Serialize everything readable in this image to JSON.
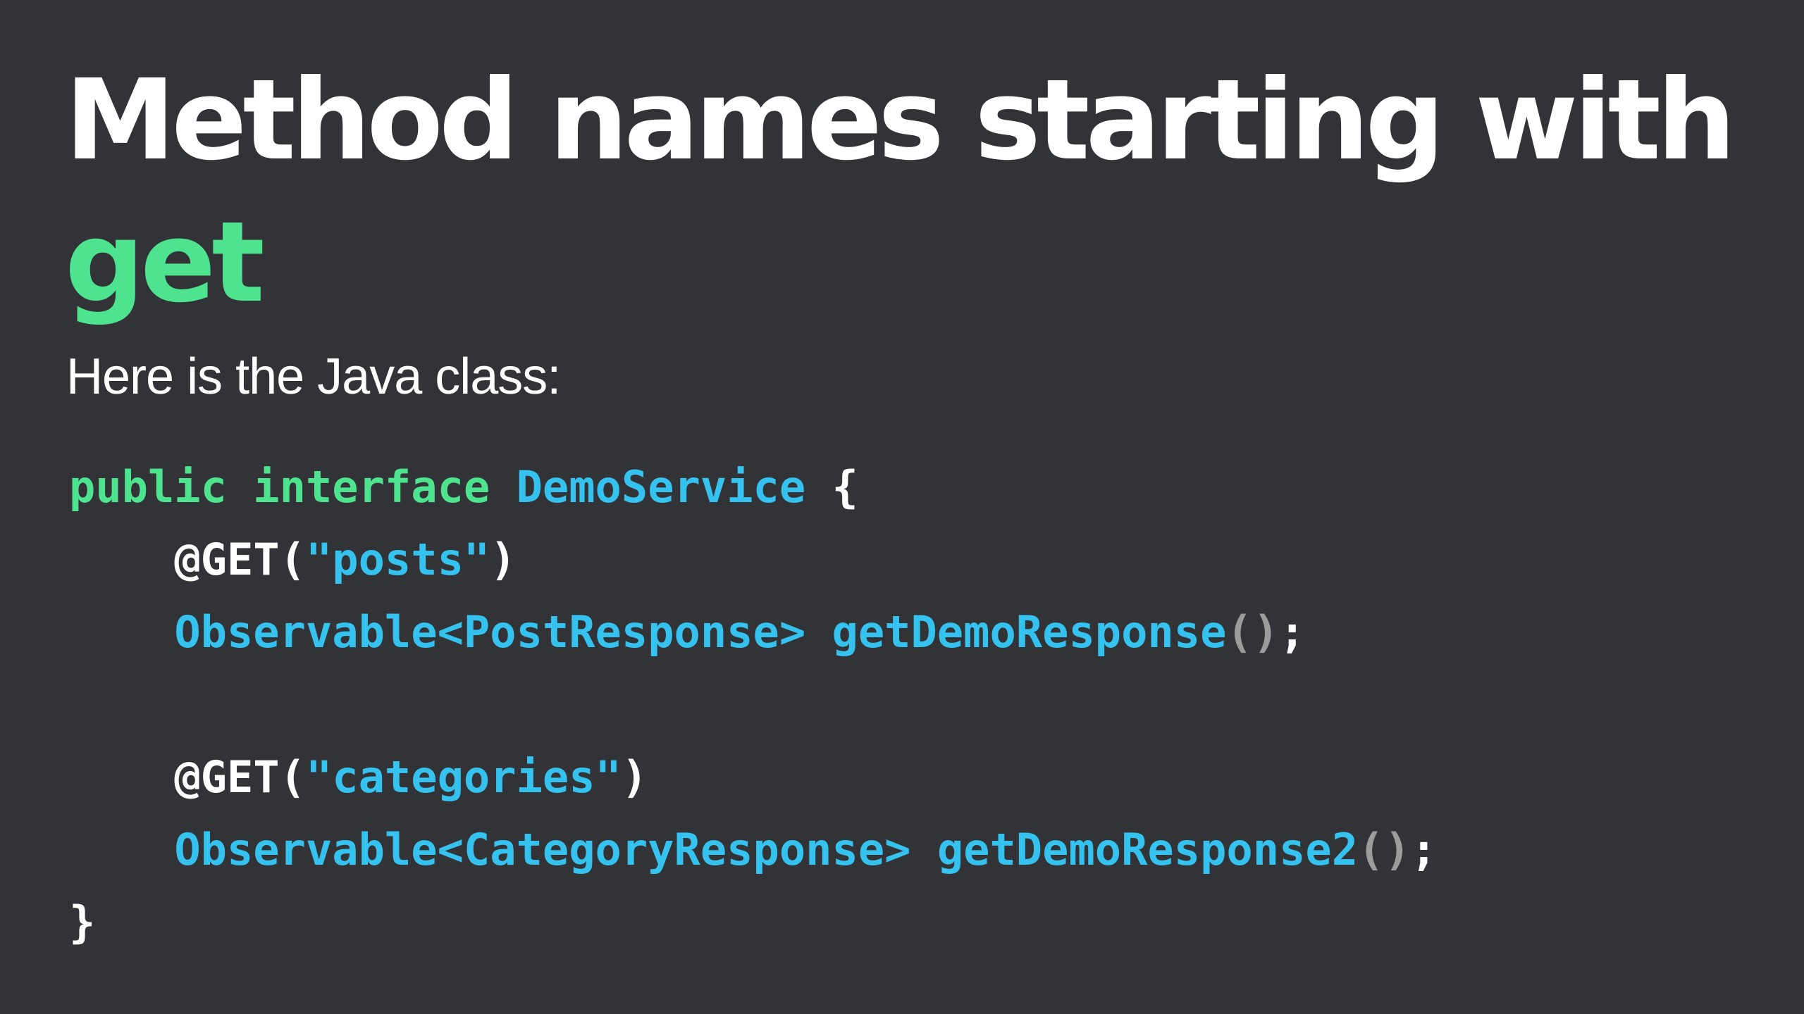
{
  "slide": {
    "title_line1": "Method names starting with",
    "title_line2": "get",
    "subtitle": "Here is the Java class:",
    "code": {
      "line1": {
        "kw1": "public",
        "kw2": "interface",
        "name": "DemoService",
        "brace": "{"
      },
      "line2": {
        "annotation": "@GET",
        "open": "(",
        "string": "\"posts\"",
        "close": ")"
      },
      "line3": {
        "type": "Observable<PostResponse>",
        "method": "getDemoResponse",
        "open": "(",
        "close": ")",
        "semi": ";"
      },
      "line5": {
        "annotation": "@GET",
        "open": "(",
        "string": "\"categories\"",
        "close": ")"
      },
      "line6": {
        "type": "Observable<CategoryResponse>",
        "method": "getDemoResponse2",
        "open": "(",
        "close": ")",
        "semi": ";"
      },
      "line7": {
        "brace": "}"
      }
    }
  },
  "colors": {
    "background": "#323337",
    "accent_green": "#4ee38e",
    "accent_blue": "#35c2ee",
    "text": "#ffffff"
  }
}
